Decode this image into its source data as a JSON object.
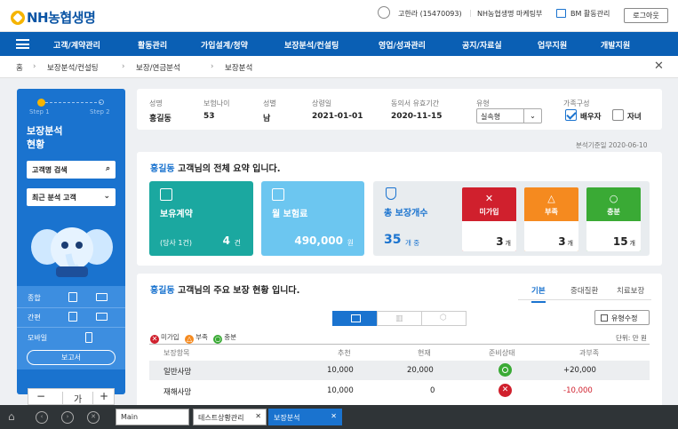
{
  "header": {
    "logo": "NH농협생명",
    "user_name": "고한라 (15470093)",
    "user_dept": "NH농협생명 마케팅부",
    "bm_label": "BM 활동관리",
    "logout": "로그아웃"
  },
  "nav": [
    "고객/계약관리",
    "활동관리",
    "가입설계/청약",
    "보장분석/컨설팅",
    "영업/성과관리",
    "공지/자료실",
    "업무지원",
    "개발지원"
  ],
  "breadcrumb": [
    "홈",
    "보장분석/컨설팅",
    "보장/연금분석",
    "보장분석"
  ],
  "sidebar": {
    "step1": "Step 1",
    "step2": "Step 2",
    "title1": "보장분석",
    "title2": "현황",
    "search": "고객명 검색",
    "recent": "최근 분석 고객",
    "links": [
      {
        "label": "종합"
      },
      {
        "label": "간편"
      },
      {
        "label": "모바일"
      }
    ],
    "report": "보고서",
    "zoom_minus": "−",
    "zoom_label": "가",
    "zoom_plus": "+"
  },
  "customer": {
    "labels": [
      "성명",
      "보험나이",
      "성별",
      "상령일",
      "동의서 유효기간",
      "유형",
      "가족구성"
    ],
    "values": [
      "홍길동",
      "53",
      "남",
      "2021-01-01",
      "2020-11-15"
    ],
    "type_value": "실속형",
    "family": [
      {
        "label": "배우자",
        "checked": true
      },
      {
        "label": "자녀",
        "checked": false
      }
    ]
  },
  "analysis_date": "분석기준일 2020-06-10",
  "summary": {
    "name": "홍길동",
    "title": " 고객님의 전체 요약 입니다.",
    "contracts": {
      "label": "보유계약",
      "sub": "(당사 1건)",
      "value": "4",
      "unit": "건"
    },
    "premium": {
      "label": "월 보험료",
      "value": "490,000",
      "unit": "원"
    },
    "coverage": {
      "label": "총 보장개수",
      "value": "35",
      "unit": "개 중"
    },
    "status": [
      {
        "label": "미가입",
        "glyph": "✕",
        "value": "3",
        "unit": "개",
        "color": "#d0202d"
      },
      {
        "label": "부족",
        "glyph": "△",
        "value": "3",
        "unit": "개",
        "color": "#f58a1f"
      },
      {
        "label": "충분",
        "glyph": "○",
        "value": "15",
        "unit": "개",
        "color": "#3aaa35"
      }
    ]
  },
  "detail": {
    "name": "홍길동",
    "title": " 고객님의 주요 보장 현황 입니다.",
    "tabs": [
      "기본",
      "중대질환",
      "치료보장"
    ],
    "edit_button": "유형수정",
    "unit": "단위: 만 원",
    "legend": [
      {
        "label": "미가입",
        "color": "#d0202d",
        "glyph": "✕"
      },
      {
        "label": "부족",
        "color": "#f58a1f",
        "glyph": "△"
      },
      {
        "label": "충분",
        "color": "#3aaa35",
        "glyph": "○"
      }
    ],
    "columns": [
      "보장항목",
      "추천",
      "현재",
      "준비상태",
      "과부족"
    ],
    "rows": [
      {
        "item": "일반사망",
        "rec": "10,000",
        "cur": "20,000",
        "status": "충분",
        "diff": "+20,000"
      },
      {
        "item": "재해사망",
        "rec": "10,000",
        "cur": "0",
        "status": "미가입",
        "diff": "-10,000"
      }
    ]
  },
  "taskbar": {
    "tabs": [
      {
        "label": "Main"
      },
      {
        "label": "테스트상황관리"
      },
      {
        "label": "보장분석"
      }
    ]
  },
  "colors": {
    "nav": "#0a5fb4",
    "accent": "#1a73cf",
    "teal": "#1ba8a0",
    "sky": "#6cc6f0"
  }
}
